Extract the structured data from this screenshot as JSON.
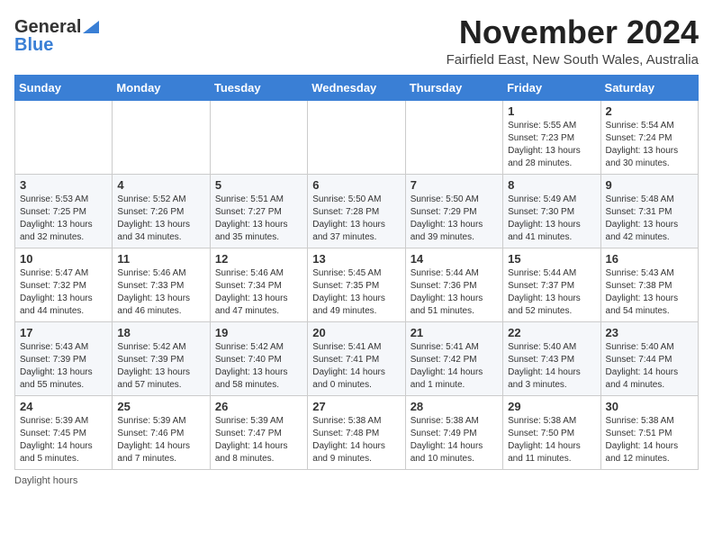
{
  "header": {
    "logo_general": "General",
    "logo_blue": "Blue",
    "month": "November 2024",
    "location": "Fairfield East, New South Wales, Australia"
  },
  "footer": {
    "daylight_label": "Daylight hours"
  },
  "days_of_week": [
    "Sunday",
    "Monday",
    "Tuesday",
    "Wednesday",
    "Thursday",
    "Friday",
    "Saturday"
  ],
  "weeks": [
    [
      {
        "day": "",
        "info": ""
      },
      {
        "day": "",
        "info": ""
      },
      {
        "day": "",
        "info": ""
      },
      {
        "day": "",
        "info": ""
      },
      {
        "day": "",
        "info": ""
      },
      {
        "day": "1",
        "info": "Sunrise: 5:55 AM\nSunset: 7:23 PM\nDaylight: 13 hours\nand 28 minutes."
      },
      {
        "day": "2",
        "info": "Sunrise: 5:54 AM\nSunset: 7:24 PM\nDaylight: 13 hours\nand 30 minutes."
      }
    ],
    [
      {
        "day": "3",
        "info": "Sunrise: 5:53 AM\nSunset: 7:25 PM\nDaylight: 13 hours\nand 32 minutes."
      },
      {
        "day": "4",
        "info": "Sunrise: 5:52 AM\nSunset: 7:26 PM\nDaylight: 13 hours\nand 34 minutes."
      },
      {
        "day": "5",
        "info": "Sunrise: 5:51 AM\nSunset: 7:27 PM\nDaylight: 13 hours\nand 35 minutes."
      },
      {
        "day": "6",
        "info": "Sunrise: 5:50 AM\nSunset: 7:28 PM\nDaylight: 13 hours\nand 37 minutes."
      },
      {
        "day": "7",
        "info": "Sunrise: 5:50 AM\nSunset: 7:29 PM\nDaylight: 13 hours\nand 39 minutes."
      },
      {
        "day": "8",
        "info": "Sunrise: 5:49 AM\nSunset: 7:30 PM\nDaylight: 13 hours\nand 41 minutes."
      },
      {
        "day": "9",
        "info": "Sunrise: 5:48 AM\nSunset: 7:31 PM\nDaylight: 13 hours\nand 42 minutes."
      }
    ],
    [
      {
        "day": "10",
        "info": "Sunrise: 5:47 AM\nSunset: 7:32 PM\nDaylight: 13 hours\nand 44 minutes."
      },
      {
        "day": "11",
        "info": "Sunrise: 5:46 AM\nSunset: 7:33 PM\nDaylight: 13 hours\nand 46 minutes."
      },
      {
        "day": "12",
        "info": "Sunrise: 5:46 AM\nSunset: 7:34 PM\nDaylight: 13 hours\nand 47 minutes."
      },
      {
        "day": "13",
        "info": "Sunrise: 5:45 AM\nSunset: 7:35 PM\nDaylight: 13 hours\nand 49 minutes."
      },
      {
        "day": "14",
        "info": "Sunrise: 5:44 AM\nSunset: 7:36 PM\nDaylight: 13 hours\nand 51 minutes."
      },
      {
        "day": "15",
        "info": "Sunrise: 5:44 AM\nSunset: 7:37 PM\nDaylight: 13 hours\nand 52 minutes."
      },
      {
        "day": "16",
        "info": "Sunrise: 5:43 AM\nSunset: 7:38 PM\nDaylight: 13 hours\nand 54 minutes."
      }
    ],
    [
      {
        "day": "17",
        "info": "Sunrise: 5:43 AM\nSunset: 7:39 PM\nDaylight: 13 hours\nand 55 minutes."
      },
      {
        "day": "18",
        "info": "Sunrise: 5:42 AM\nSunset: 7:39 PM\nDaylight: 13 hours\nand 57 minutes."
      },
      {
        "day": "19",
        "info": "Sunrise: 5:42 AM\nSunset: 7:40 PM\nDaylight: 13 hours\nand 58 minutes."
      },
      {
        "day": "20",
        "info": "Sunrise: 5:41 AM\nSunset: 7:41 PM\nDaylight: 14 hours\nand 0 minutes."
      },
      {
        "day": "21",
        "info": "Sunrise: 5:41 AM\nSunset: 7:42 PM\nDaylight: 14 hours\nand 1 minute."
      },
      {
        "day": "22",
        "info": "Sunrise: 5:40 AM\nSunset: 7:43 PM\nDaylight: 14 hours\nand 3 minutes."
      },
      {
        "day": "23",
        "info": "Sunrise: 5:40 AM\nSunset: 7:44 PM\nDaylight: 14 hours\nand 4 minutes."
      }
    ],
    [
      {
        "day": "24",
        "info": "Sunrise: 5:39 AM\nSunset: 7:45 PM\nDaylight: 14 hours\nand 5 minutes."
      },
      {
        "day": "25",
        "info": "Sunrise: 5:39 AM\nSunset: 7:46 PM\nDaylight: 14 hours\nand 7 minutes."
      },
      {
        "day": "26",
        "info": "Sunrise: 5:39 AM\nSunset: 7:47 PM\nDaylight: 14 hours\nand 8 minutes."
      },
      {
        "day": "27",
        "info": "Sunrise: 5:38 AM\nSunset: 7:48 PM\nDaylight: 14 hours\nand 9 minutes."
      },
      {
        "day": "28",
        "info": "Sunrise: 5:38 AM\nSunset: 7:49 PM\nDaylight: 14 hours\nand 10 minutes."
      },
      {
        "day": "29",
        "info": "Sunrise: 5:38 AM\nSunset: 7:50 PM\nDaylight: 14 hours\nand 11 minutes."
      },
      {
        "day": "30",
        "info": "Sunrise: 5:38 AM\nSunset: 7:51 PM\nDaylight: 14 hours\nand 12 minutes."
      }
    ]
  ]
}
